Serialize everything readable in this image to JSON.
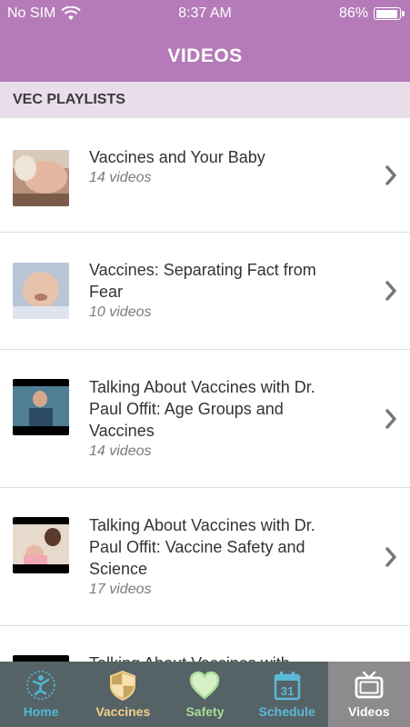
{
  "status_bar": {
    "carrier": "No SIM",
    "time": "8:37 AM",
    "battery": "86%"
  },
  "header": {
    "title": "VIDEOS"
  },
  "section": {
    "title": "VEC PLAYLISTS"
  },
  "playlists": [
    {
      "title": "Vaccines and Your Baby",
      "count": "14 videos"
    },
    {
      "title": "Vaccines: Separating Fact from Fear",
      "count": "10 videos"
    },
    {
      "title": "Talking About Vaccines with Dr. Paul Offit: Age Groups and Vaccines",
      "count": "14 videos"
    },
    {
      "title": "Talking About Vaccines with Dr. Paul Offit: Vaccine Safety and Science",
      "count": "17 videos"
    },
    {
      "title": "Talking About Vaccines with",
      "count": ""
    }
  ],
  "tabs": [
    {
      "label": "Home",
      "icon": "home-figure-icon",
      "color": "#4fb8d6"
    },
    {
      "label": "Vaccines",
      "icon": "shield-icon",
      "color": "#f2d08a"
    },
    {
      "label": "Safety",
      "icon": "heart-icon",
      "color": "#a9dd96"
    },
    {
      "label": "Schedule",
      "icon": "calendar-icon",
      "calendar_day": "31",
      "color": "#5bb9d8"
    },
    {
      "label": "Videos",
      "icon": "tv-icon",
      "color": "#ffffff",
      "active": true
    }
  ],
  "colors": {
    "header": "#b47bb8",
    "section": "#e9dceb",
    "tab_bar": "#566366",
    "tab_active": "#8e8b8e"
  }
}
